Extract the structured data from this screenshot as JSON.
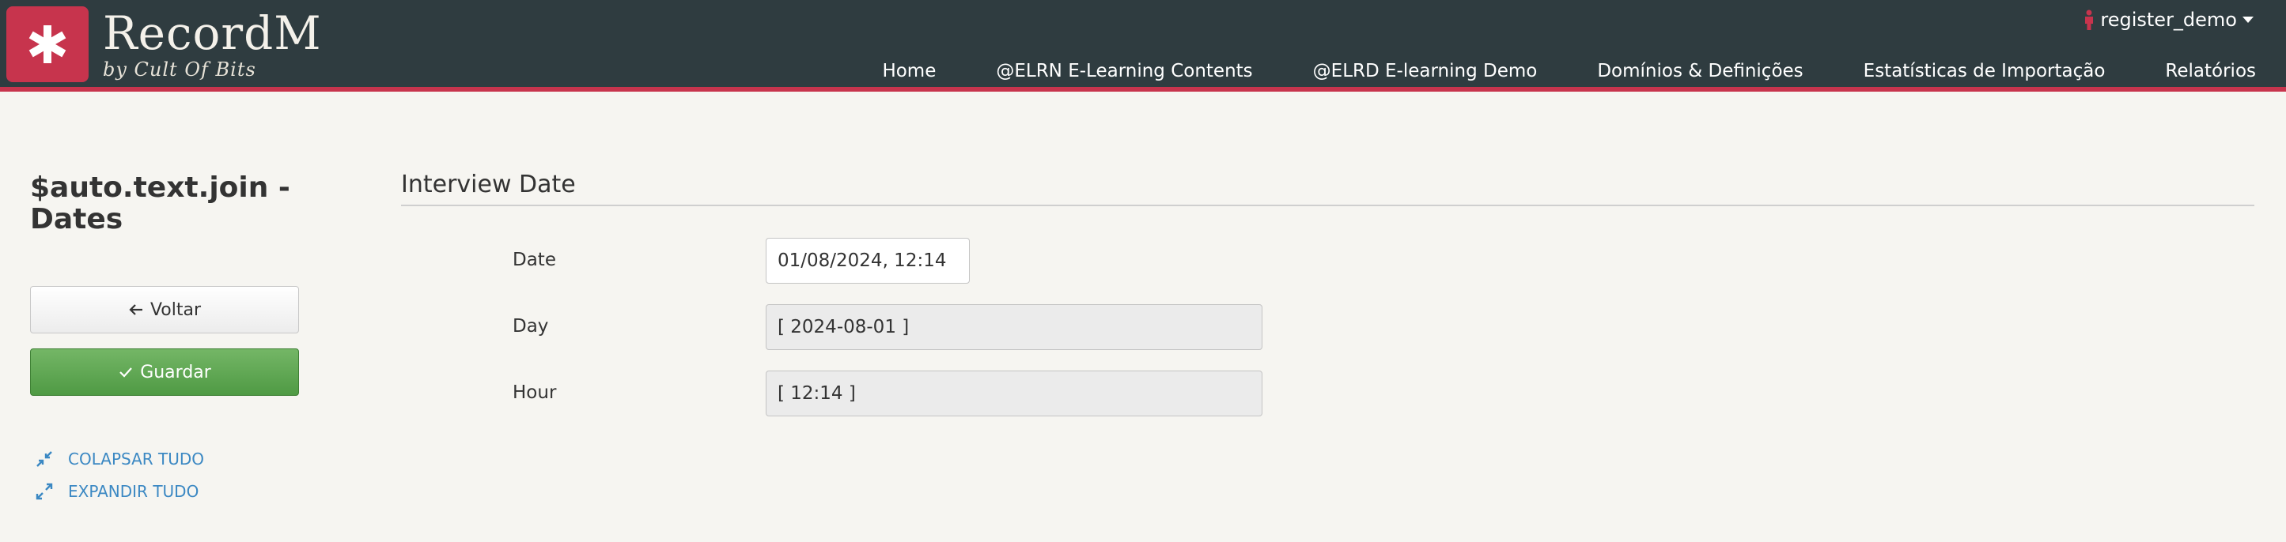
{
  "header": {
    "brand_name": "RecordM",
    "brand_sub": "by Cult Of Bits",
    "user_label": "register_demo",
    "nav": [
      {
        "label": "Home"
      },
      {
        "label": "@ELRN E-Learning Contents"
      },
      {
        "label": "@ELRD E-learning Demo"
      },
      {
        "label": "Domínios & Definições"
      },
      {
        "label": "Estatísticas de Importação"
      },
      {
        "label": "Relatórios"
      }
    ],
    "colors": {
      "bar": "#2f3c40",
      "accent": "#c7344d"
    }
  },
  "sidebar": {
    "title": "$auto.text.join - Dates",
    "back_label": "Voltar",
    "save_label": "Guardar",
    "collapse_label": "COLAPSAR TUDO",
    "expand_label": "EXPANDIR TUDO",
    "icons": {
      "back": "arrow-left-icon",
      "save": "check-icon",
      "collapse": "compress-icon",
      "expand": "expand-icon"
    }
  },
  "form": {
    "section_title": "Interview Date",
    "fields": [
      {
        "label": "Date",
        "value": "01/08/2024, 12:14",
        "editable": true
      },
      {
        "label": "Day",
        "value": "[ 2024-08-01 ]",
        "editable": false
      },
      {
        "label": "Hour",
        "value": "[ 12:14 ]",
        "editable": false
      }
    ]
  }
}
